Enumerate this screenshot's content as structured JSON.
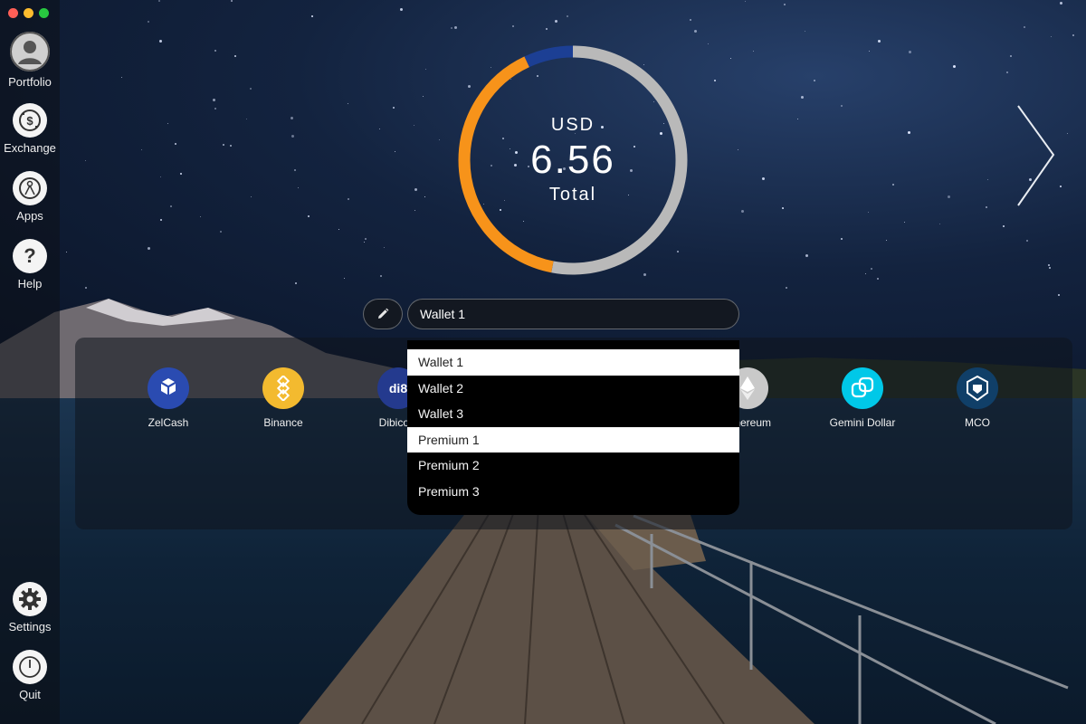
{
  "window": {
    "controls": [
      "#ff5f57",
      "#febc2e",
      "#28c840"
    ]
  },
  "sidebar": {
    "items": [
      {
        "label": "Portfolio",
        "icon": "user-avatar-icon"
      },
      {
        "label": "Exchange",
        "icon": "exchange-icon"
      },
      {
        "label": "Apps",
        "icon": "apps-icon"
      },
      {
        "label": "Help",
        "icon": "help-icon"
      },
      {
        "label": "Settings",
        "icon": "gear-icon"
      },
      {
        "label": "Quit",
        "icon": "power-icon"
      }
    ]
  },
  "portfolio": {
    "currency": "USD",
    "total": "6.56",
    "caption": "Total",
    "breakdown": [
      {
        "fraction": 0.4,
        "color": "#f7931a"
      },
      {
        "fraction": 0.07,
        "color": "#1c3f94"
      },
      {
        "fraction": 0.53,
        "color": "#b9b9b9"
      }
    ]
  },
  "wallet": {
    "selected": "Wallet 1",
    "options": [
      "Wallet 1",
      "Wallet 2",
      "Wallet 3",
      "Premium 1",
      "Premium 2",
      "Premium 3"
    ],
    "highlighted": [
      "Wallet 1",
      "Premium 1"
    ]
  },
  "coins": [
    {
      "label": "ZelCash",
      "color": "#2a4bb1"
    },
    {
      "label": "Binance",
      "color": "#f3ba2f"
    },
    {
      "label": "Dibicoin",
      "color": "#243a8e"
    },
    {
      "label": "Ethereum",
      "color": "#c9c9c9"
    },
    {
      "label": "Gemini Dollar",
      "color": "#00dcfa"
    },
    {
      "label": "MCO",
      "color": "#103f68"
    }
  ]
}
